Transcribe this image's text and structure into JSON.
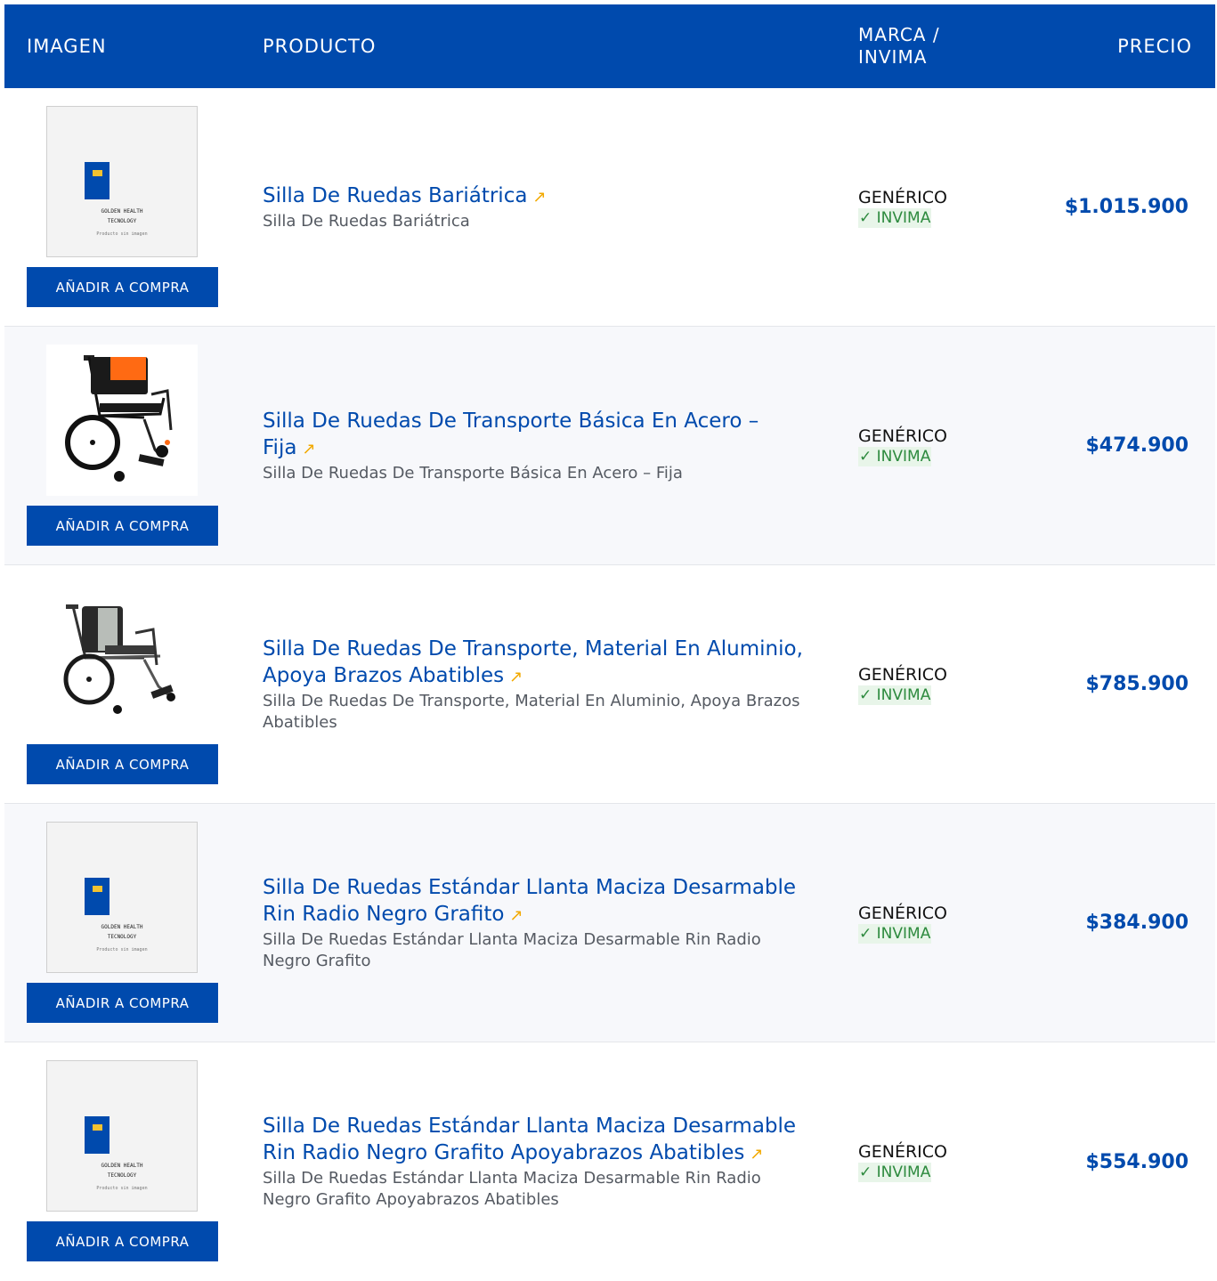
{
  "header": {
    "col_image": "IMAGEN",
    "col_product": "PRODUCTO",
    "col_brand": "MARCA / INVIMA",
    "col_price": "PRECIO"
  },
  "placeholder": {
    "brand": "GOLDEN HEALTH\nTECNOLOGY",
    "note": "Producto sin imagen"
  },
  "products": [
    {
      "title": "Silla De Ruedas Bariátrica",
      "subtitle": "Silla De Ruedas Bariátrica",
      "brand": "GENÉRICO",
      "invima": "✓ INVIMA",
      "price": "$1.015.900",
      "button": "AÑADIR A COMPRA",
      "image": "placeholder"
    },
    {
      "title": "Silla De Ruedas De Transporte Básica En Acero – Fija",
      "subtitle": "Silla De Ruedas De Transporte Básica En Acero – Fija",
      "brand": "GENÉRICO",
      "invima": "✓ INVIMA",
      "price": "$474.900",
      "button": "AÑADIR A COMPRA",
      "image": "wheelchair-orange"
    },
    {
      "title": "Silla De Ruedas De Transporte, Material En Aluminio, Apoya Brazos Abatibles",
      "subtitle": "Silla De Ruedas De Transporte, Material En Aluminio, Apoya Brazos Abatibles",
      "brand": "GENÉRICO",
      "invima": "✓ INVIMA",
      "price": "$785.900",
      "button": "AÑADIR A COMPRA",
      "image": "wheelchair-grey"
    },
    {
      "title": "Silla De Ruedas Estándar Llanta Maciza Desarmable Rin Radio Negro Grafito",
      "subtitle": "Silla De Ruedas Estándar Llanta Maciza Desarmable Rin Radio Negro Grafito",
      "brand": "GENÉRICO",
      "invima": "✓ INVIMA",
      "price": "$384.900",
      "button": "AÑADIR A COMPRA",
      "image": "placeholder"
    },
    {
      "title": "Silla De Ruedas Estándar Llanta Maciza Desarmable Rin Radio Negro Grafito Apoyabrazos Abatibles",
      "subtitle": "Silla De Ruedas Estándar Llanta Maciza Desarmable Rin Radio Negro Grafito Apoyabrazos Abatibles",
      "brand": "GENÉRICO",
      "invima": "✓ INVIMA",
      "price": "$554.900",
      "button": "AÑADIR A COMPRA",
      "image": "placeholder"
    }
  ],
  "icons": {
    "external_link": "↗"
  },
  "colors": {
    "primary": "#004aad",
    "arrow": "#f2a900",
    "invima_text": "#2d8a3e",
    "invima_bg": "#e8f5e9",
    "placeholder_accent": "#f2c230"
  }
}
